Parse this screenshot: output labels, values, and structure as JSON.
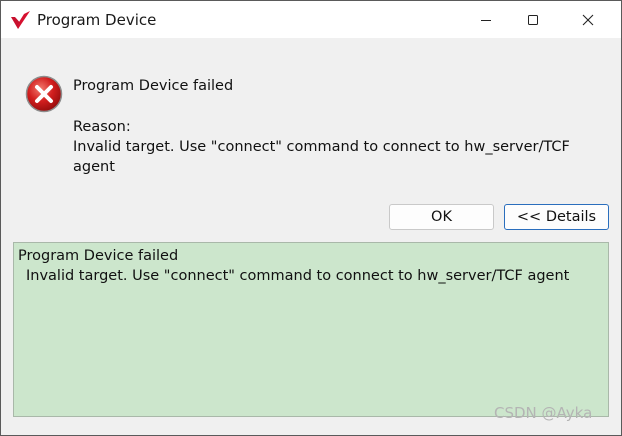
{
  "window": {
    "title": "Program Device",
    "app_icon": "xilinx-vivado-logo",
    "controls": [
      "minimize-icon",
      "maximize-icon",
      "close-icon"
    ]
  },
  "message": {
    "icon": "error-icon",
    "headline": "Program Device failed",
    "reason_label": "Reason:",
    "reason_line1": "Invalid target. Use \"connect\" command to connect to hw_server/TCF",
    "reason_line2": "agent"
  },
  "buttons": {
    "ok_label": "OK",
    "details_label": "<< Details"
  },
  "details": {
    "line1": "Program Device failed",
    "line2": "Invalid target. Use \"connect\" command to connect to hw_server/TCF agent"
  },
  "watermark": "CSDN @Ayka",
  "colors": {
    "titlebar": "#ffffff",
    "dialog_bg": "#f0f0f0",
    "details_bg": "#cce6cc",
    "error_red": "#d21e1e",
    "logo_red": "#c8102e",
    "focus_border": "#2a6ebd"
  }
}
